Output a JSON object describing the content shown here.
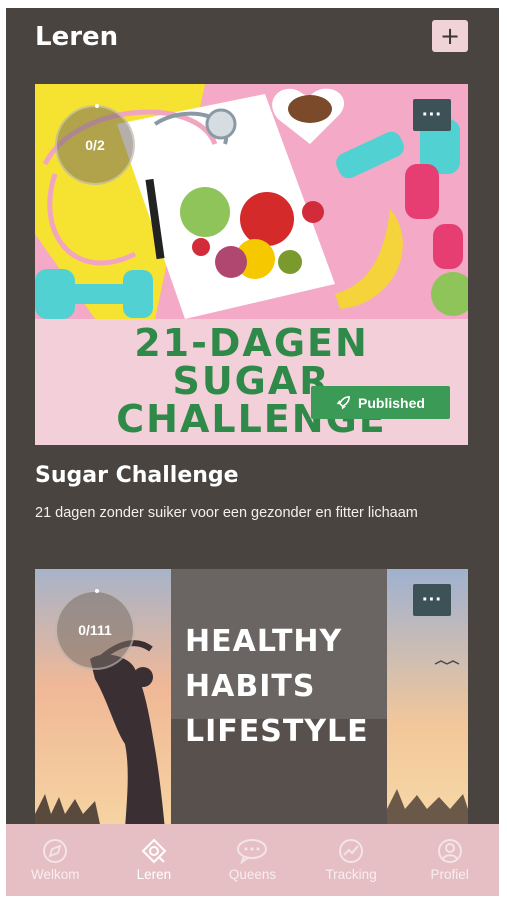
{
  "header": {
    "title": "Leren",
    "add_label": "+"
  },
  "cards": [
    {
      "progress": "0/2",
      "menu_label": "···",
      "image_text": [
        "21-DAGEN",
        "SUGAR",
        "CHALLENGE"
      ],
      "status": "Published",
      "title": "Sugar Challenge",
      "description": "21 dagen zonder suiker voor een gezonder en fitter lichaam"
    },
    {
      "progress": "0/111",
      "menu_label": "···",
      "image_text": [
        "HEALTHY",
        "HABITS",
        "LIFESTYLE"
      ]
    }
  ],
  "tabs": [
    {
      "label": "Welkom",
      "icon": "compass-icon",
      "active": false
    },
    {
      "label": "Leren",
      "icon": "learn-icon",
      "active": true
    },
    {
      "label": "Queens",
      "icon": "chat-icon",
      "active": false
    },
    {
      "label": "Tracking",
      "icon": "tracking-icon",
      "active": false
    },
    {
      "label": "Profiel",
      "icon": "profile-icon",
      "active": false
    }
  ],
  "colors": {
    "background": "#4a4441",
    "accent_pink": "#e5bfc4",
    "published_green": "#3a9a56",
    "title_green": "#2f8a49"
  }
}
